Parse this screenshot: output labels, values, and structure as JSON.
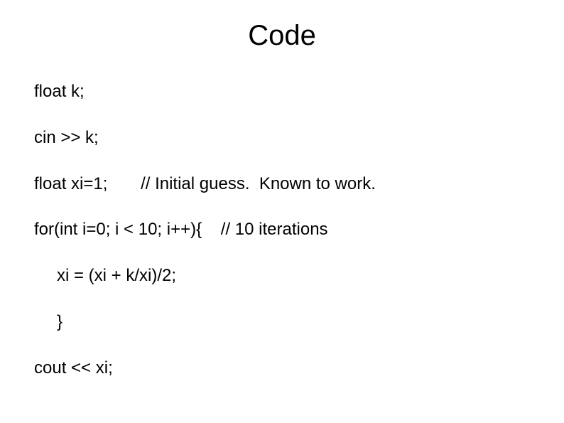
{
  "title": "Code",
  "lines": {
    "l1": "float k;",
    "l2": "cin >> k;",
    "l3": "float xi=1;       // Initial guess.  Known to work.",
    "l4": "for(int i=0; i < 10; i++){    // 10 iterations",
    "l5": "xi = (xi + k/xi)/2;",
    "l6": "}",
    "l7": "cout << xi;"
  }
}
